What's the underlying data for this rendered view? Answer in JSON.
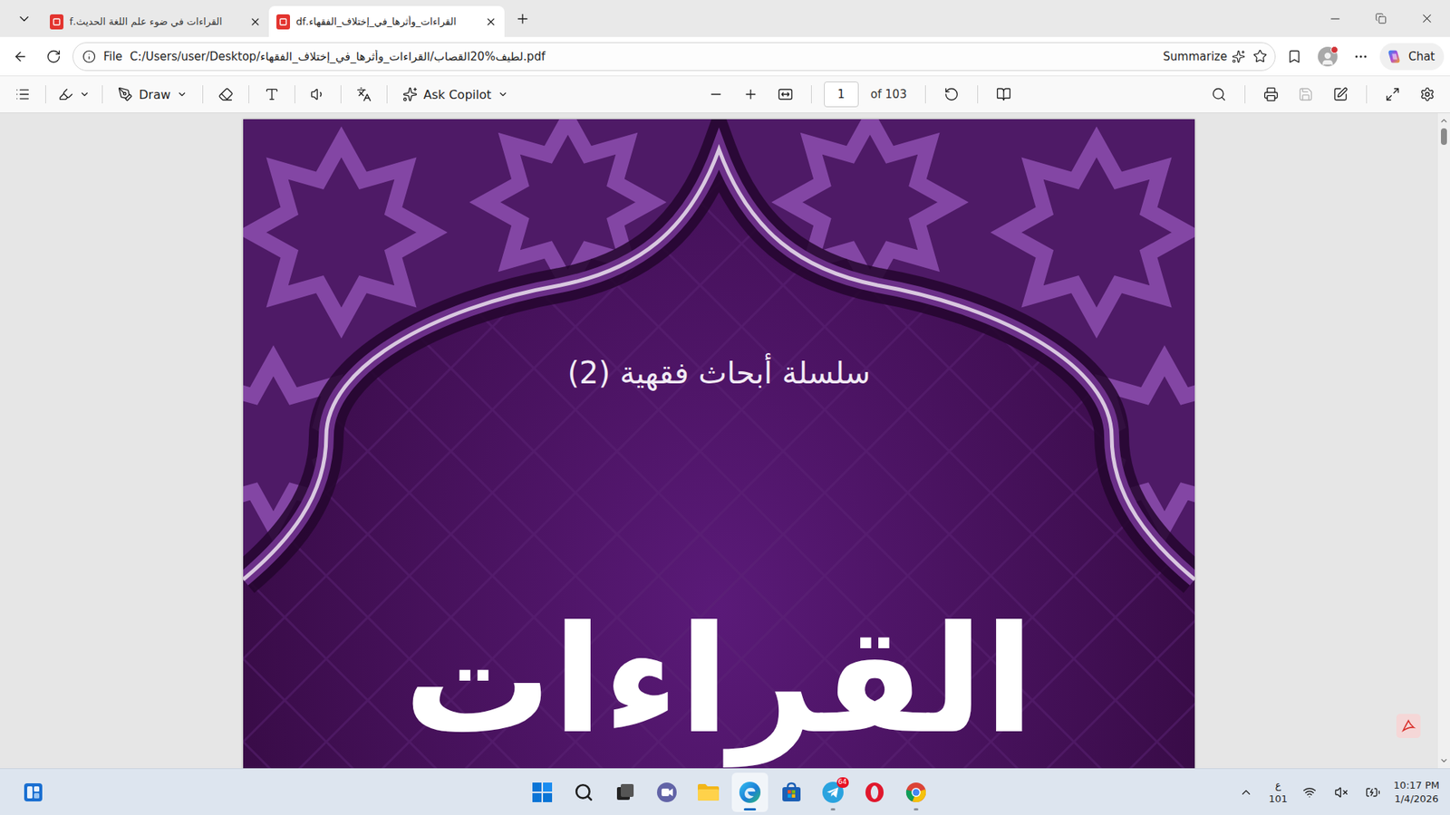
{
  "tabs": [
    {
      "label": "القراءات في ضوء علم اللغة الحديث.f",
      "selected": false
    },
    {
      "label": "القراءات_وأثرها_في_إختلاف_الفقهاء.df",
      "selected": true
    }
  ],
  "address_bar": {
    "scheme": "File",
    "url": "C:/Users/user/Desktop/لطيف%20القصاب/القراءات_وأثرها_في_إختلاف_الفقهاء.pdf",
    "summarize": "Summarize",
    "favorite": false
  },
  "profile": {
    "notification": true
  },
  "chat_button": {
    "label": "Chat"
  },
  "pdf_toolbar": {
    "draw": "Draw",
    "ask_copilot": "Ask Copilot",
    "page": "1",
    "page_count": "of 103",
    "save_enabled": false
  },
  "document": {
    "series": "سلسلة أبحاث فقهية (2)",
    "title": "القراءات"
  },
  "taskbar": {
    "apps": [
      {
        "kind": "start",
        "running": false,
        "active": false
      },
      {
        "kind": "search",
        "running": false,
        "active": false
      },
      {
        "kind": "taskview",
        "running": false,
        "active": false
      },
      {
        "kind": "meet",
        "running": false,
        "active": false
      },
      {
        "kind": "explorer",
        "running": false,
        "active": false
      },
      {
        "kind": "edge",
        "running": true,
        "active": true
      },
      {
        "kind": "store",
        "running": false,
        "active": false
      },
      {
        "kind": "telegram",
        "running": true,
        "active": false,
        "badge": "64"
      },
      {
        "kind": "opera",
        "running": false,
        "active": false
      },
      {
        "kind": "chrome",
        "running": true,
        "active": false
      }
    ]
  },
  "system_tray": {
    "input_language": "ع",
    "input_layout": "101",
    "muted": true,
    "time": "10:17 PM",
    "date": "1/4/2026"
  }
}
